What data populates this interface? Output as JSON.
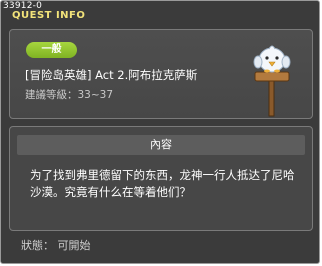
{
  "window": {
    "id_label": "33912-0",
    "title": "QUEST INFO"
  },
  "quest": {
    "badge": "一般",
    "name": "[冒险岛英雄] Act 2.阿布拉克萨斯",
    "level_label": "建議等級：33~37"
  },
  "content": {
    "header": "內容",
    "description": "为了找到弗里德留下的东西，龙神一行人抵达了尼哈沙漠。究竟有什么在等着他们？"
  },
  "status_label": "狀態： 可開始",
  "icons": {
    "npc": "penguin-sign-npc-icon"
  },
  "colors": {
    "title": "#f2e37a",
    "badge": "#8dc52c",
    "background": "#3b3b3b"
  }
}
